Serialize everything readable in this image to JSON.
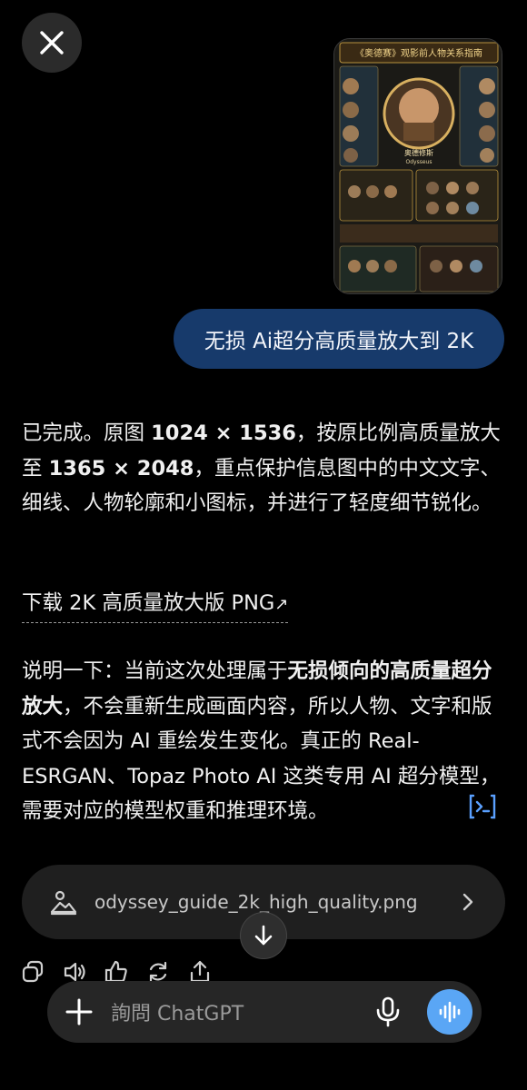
{
  "header": {
    "close_icon": "close-icon"
  },
  "attachment": {
    "thumbnail_title": "《奥德赛》观影前人物关系指南",
    "thumbnail_center_name": "奥德修斯",
    "thumbnail_center_sub": "Odysseus"
  },
  "user_message": {
    "text": "无损 Ai超分高质量放大到 2K"
  },
  "assistant": {
    "p1_a": "已完成。原图 ",
    "p1_b1": "1024 × 1536",
    "p1_c": "，按原比例高质量放大至 ",
    "p1_b2": "1365 × 2048",
    "p1_d": "，重点保护信息图中的中文文字、细线、人物轮廓和小图标，并进行了轻度细节锐化。",
    "download_label": "下载 2K 高质量放大版 PNG",
    "download_arrow": "↗",
    "p3_a": "说明一下：当前这次处理属于",
    "p3_b": "无损倾向的高质量超分放大",
    "p3_c": "，不会重新生成画面内容，所以人物、文字和版式不会因为 AI 重绘发生变化。真正的 Real-ESRGAN、Topaz Photo AI 这类专用 AI 超分模型，需要对应的模型权重和推理环境。"
  },
  "file_card": {
    "icon": "image-file-icon",
    "name": "odyssey_guide_2k_high_quality.png"
  },
  "actions": [
    "copy-icon",
    "speaker-icon",
    "thumbs-up-icon",
    "regenerate-icon",
    "share-icon"
  ],
  "composer": {
    "placeholder": "詢問 ChatGPT"
  },
  "colors": {
    "background": "#000000",
    "user_bubble": "#173a6b",
    "accent": "#5aa6f5",
    "card": "#1f1f1f"
  }
}
